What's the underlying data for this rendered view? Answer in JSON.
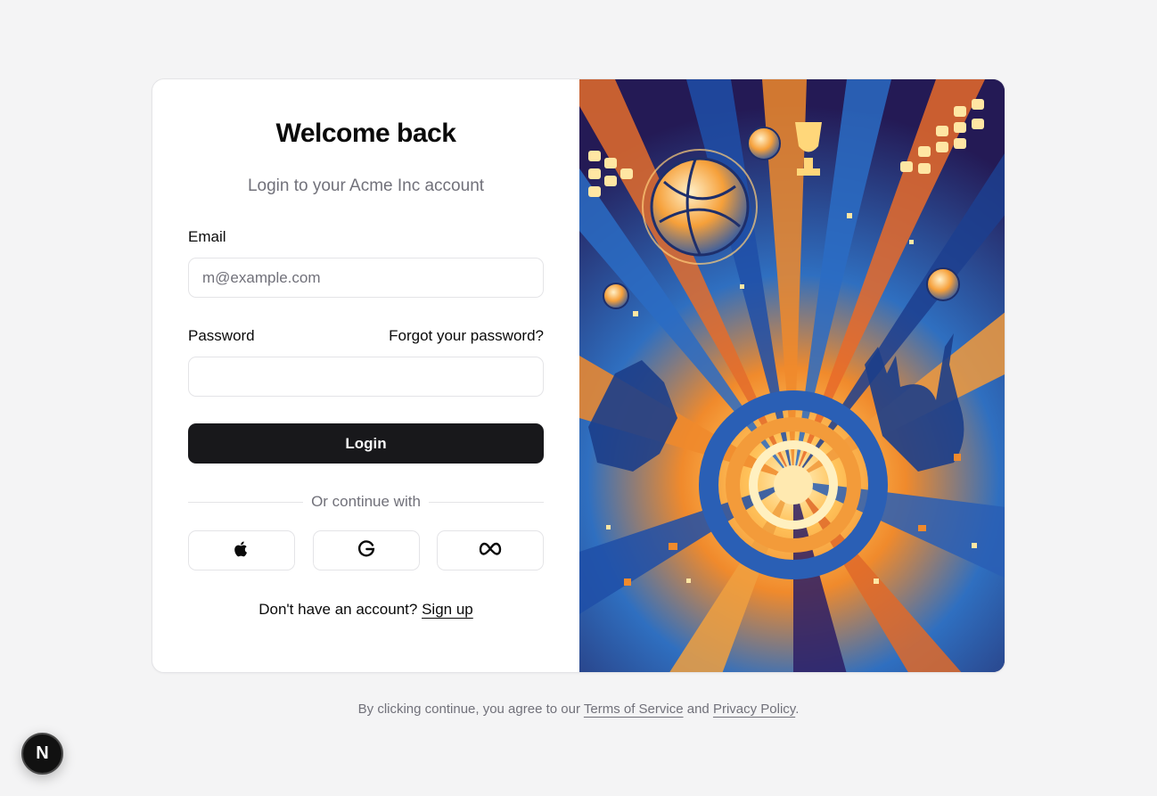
{
  "login": {
    "title": "Welcome back",
    "subtitle": "Login to your Acme Inc account",
    "email_label": "Email",
    "email_placeholder": "m@example.com",
    "email_value": "",
    "password_label": "Password",
    "password_value": "",
    "forgot_link": "Forgot your password?",
    "login_button": "Login",
    "divider_text": "Or continue with",
    "social_buttons": [
      {
        "provider": "Apple",
        "icon": "apple-icon"
      },
      {
        "provider": "Google",
        "icon": "google-icon"
      },
      {
        "provider": "Meta",
        "icon": "meta-icon"
      }
    ],
    "signup_prompt": "Don't have an account?",
    "signup_link": "Sign up"
  },
  "hero_image": {
    "description_icon": "volleyball-illustration"
  },
  "legal": {
    "prefix": "By clicking continue, you agree to our",
    "terms_link": "Terms of Service",
    "conjunction": "and",
    "privacy_link": "Privacy Policy",
    "suffix": "."
  },
  "dev_badge": {
    "letter": "N"
  },
  "colors": {
    "background": "#f4f4f5",
    "card": "#ffffff",
    "primary_button": "#18181b",
    "muted_text": "#71717a",
    "border": "#e4e4e7"
  }
}
